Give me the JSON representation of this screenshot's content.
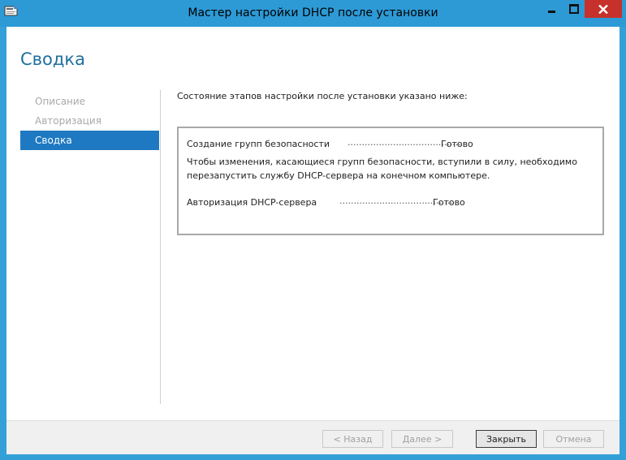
{
  "window": {
    "title": "Мастер настройки DHCP после установки",
    "accent_color": "#2d9ad6",
    "close_color": "#c7312b"
  },
  "page": {
    "title": "Сводка"
  },
  "nav": {
    "items": [
      {
        "label": "Описание",
        "active": false
      },
      {
        "label": "Авторизация",
        "active": false
      },
      {
        "label": "Сводка",
        "active": true
      }
    ]
  },
  "content": {
    "intro": "Состояние этапов настройки после установки указано ниже:",
    "steps": [
      {
        "name": "Создание групп безопасности",
        "leader": "........................................",
        "status": "Готово"
      },
      {
        "name": "Авторизация DHCP-сервера",
        "leader": "........................................",
        "status": "Готово"
      }
    ],
    "note": "Чтобы изменения, касающиеся групп безопасности, вступили в силу, необходимо перезапустить службу DHCP-сервера на конечном компьютере."
  },
  "buttons": {
    "back": "< Назад",
    "next": "Далее >",
    "close": "Закрыть",
    "cancel": "Отмена"
  }
}
